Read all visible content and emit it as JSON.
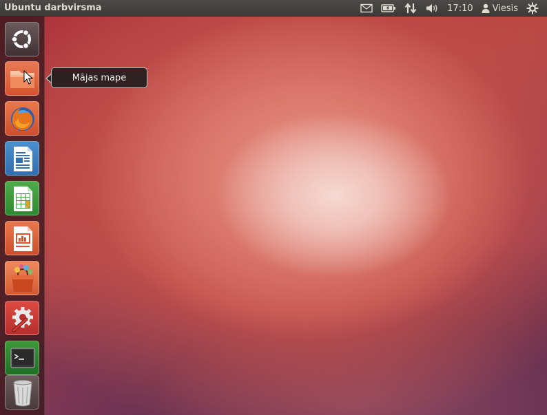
{
  "top_panel": {
    "title": "Ubuntu darbvirsma",
    "clock": "17:10",
    "user": "Viesis",
    "icons": [
      "mail-icon",
      "battery-icon",
      "network-icon",
      "volume-icon",
      "user-icon",
      "settings-gear-icon"
    ]
  },
  "launcher": {
    "items": [
      {
        "name": "dash-home",
        "icon": "ubuntu-logo-icon"
      },
      {
        "name": "home-folder",
        "icon": "folder-icon",
        "tooltip": "Mājas mape"
      },
      {
        "name": "firefox",
        "icon": "firefox-icon"
      },
      {
        "name": "libreoffice-writer",
        "icon": "writer-icon"
      },
      {
        "name": "libreoffice-calc",
        "icon": "calc-icon"
      },
      {
        "name": "libreoffice-impress",
        "icon": "impress-icon"
      },
      {
        "name": "software-center",
        "icon": "shopping-bag-icon"
      },
      {
        "name": "system-settings",
        "icon": "settings-wrench-icon"
      },
      {
        "name": "terminal",
        "icon": "terminal-icon"
      },
      {
        "name": "trash",
        "icon": "trash-icon"
      }
    ]
  },
  "tooltip": {
    "label": "Mājas mape"
  },
  "colors": {
    "panel": "#3c3b37",
    "launcher": "#3c191e",
    "accent": "#dd4814"
  }
}
